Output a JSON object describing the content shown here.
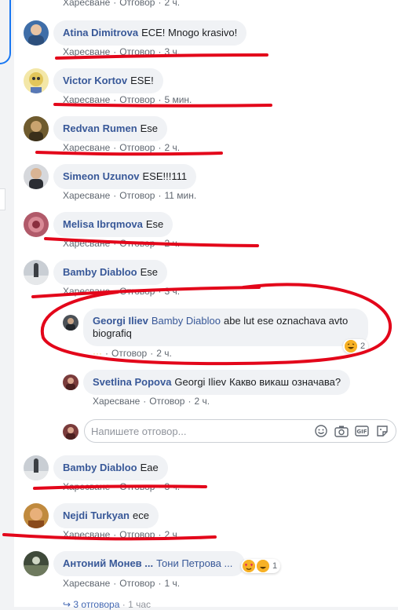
{
  "comments": [
    {
      "name": "Atina Dimitrova",
      "text": "ECE! Mnogo krasivo!",
      "like": "Харесване",
      "reply": "Отговор",
      "time": "3 ч.",
      "avatar_color": "#3f6ea8"
    },
    {
      "name": "Victor Kortov",
      "text": "ESE!",
      "like": "Харесване",
      "reply": "Отговор",
      "time": "5 мин.",
      "avatar_color": "#e2c65a"
    },
    {
      "name": "Redvan Rumen",
      "text": "Ese",
      "like": "Харесване",
      "reply": "Отговор",
      "time": "2 ч.",
      "avatar_color": "#6f5b2e"
    },
    {
      "name": "Simeon Uzunov",
      "text": "ESE!!!111",
      "like": "Харесване",
      "reply": "Отговор",
      "time": "11 мин.",
      "avatar_color": "#2b2d33"
    },
    {
      "name": "Melisa Ibrqmova",
      "text": "Ese",
      "like": "Харесване",
      "reply": "Отговор",
      "time": "2 ч.",
      "avatar_color": "#b15a6a"
    },
    {
      "name": "Bamby Diabloo",
      "text": "Ese",
      "like": "Харесване",
      "reply": "Отговор",
      "time": "3 ч.",
      "avatar_color": "#9aa1a8"
    }
  ],
  "replies": [
    {
      "name": "Georgi Iliev",
      "tag": "Bamby Diabloo",
      "text1": "abe lut ese oznachava avto",
      "text2": "biografiq",
      "reply": "Отговор",
      "time": "2 ч.",
      "reactions": "2",
      "avatar_color": "#4b5157"
    },
    {
      "name": "Svetlina Popova",
      "tag": "Georgi Iliev",
      "text": "Какво викаш означава?",
      "like": "Харесване",
      "reply": "Отговор",
      "time": "2 ч.",
      "avatar_color": "#7a3b3b"
    }
  ],
  "reply_box": {
    "placeholder": "Напишете отговор...",
    "avatar_color": "#7a3b3b"
  },
  "comments2": [
    {
      "name": "Bamby Diabloo",
      "text": "Eae",
      "like": "Харесване",
      "reply": "Отговор",
      "time": "3 ч.",
      "avatar_color": "#9aa1a8"
    },
    {
      "name": "Nejdi Turkyan",
      "text": "ece",
      "like": "Харесване",
      "reply": "Отговор",
      "time": "2 ч.",
      "avatar_color": "#c08a3e"
    },
    {
      "name": "Антоний Монев ...",
      "text": "Тони Петрова ...",
      "like": "Харесване",
      "reply": "Отговор",
      "time": "1 ч.",
      "reactions": "1",
      "avatar_color": "#3f4a3a"
    }
  ],
  "top_partial": {
    "like": "Харесване",
    "reply": "Отговор",
    "time": "2 ч."
  },
  "bottom": {
    "replies_label": "3 отговора",
    "time": "1 час"
  },
  "colors": {
    "name_link": "#385898",
    "meta": "#606770",
    "bubble": "#f0f2f5",
    "annotation": "#e3061a"
  }
}
